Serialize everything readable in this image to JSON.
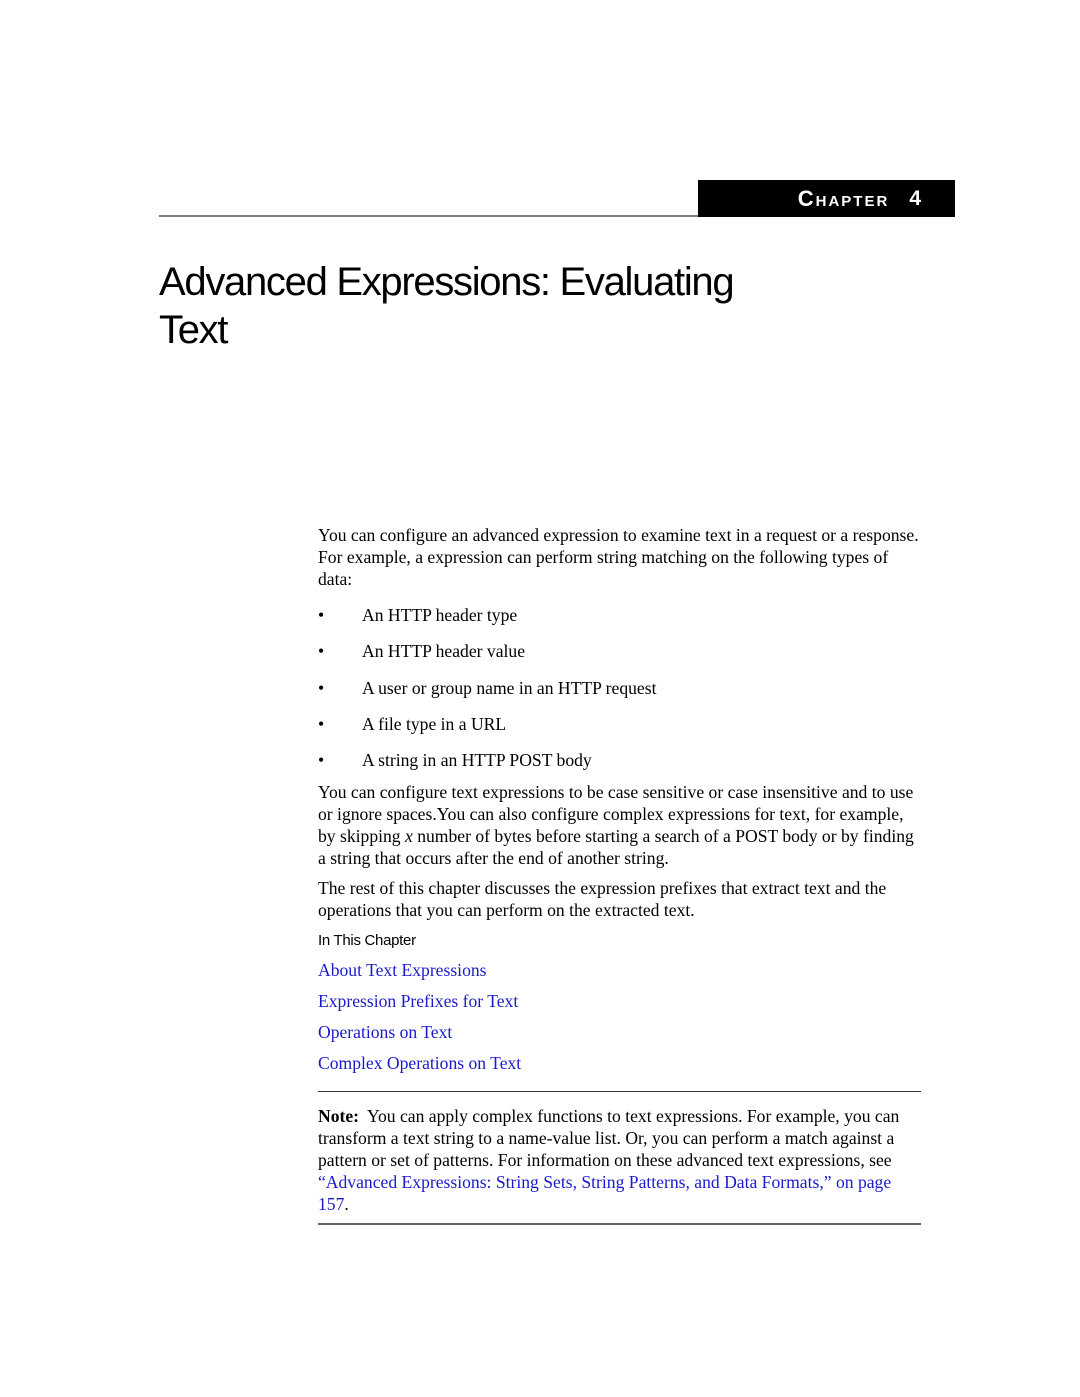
{
  "header": {
    "chapter_label": "Chapter",
    "chapter_number": "4"
  },
  "title": {
    "line1": "Advanced Expressions: Evaluating",
    "line2": "Text"
  },
  "intro": "You can configure an advanced expression to examine text in a request or a response. For example, a expression can perform string matching on the following types of data:",
  "bullets": [
    "An HTTP header type",
    "An HTTP header value",
    "A user or group name in an HTTP request",
    "A file type in a URL",
    "A string in an HTTP POST body"
  ],
  "bullet_glyph": "•",
  "paragraph2": {
    "before_italic": "You can configure text expressions to be case sensitive or case insensitive and to use or ignore spaces.You can also configure complex expressions for text, for example, by skipping ",
    "italic": "x",
    "after_italic": " number of bytes before starting a search of a POST body or by finding a string that occurs after the end of another string."
  },
  "paragraph3": "The rest of this chapter discusses the expression prefixes that extract text and the operations that you can perform on the extracted text.",
  "in_this_chapter": {
    "heading": "In This Chapter",
    "links": [
      "About Text Expressions",
      "Expression Prefixes for Text",
      "Operations on Text",
      "Complex Operations on Text"
    ]
  },
  "note": {
    "label": "Note:",
    "text": "You can apply complex functions to text expressions. For example, you can transform a text string to a name-value list. Or, you can perform a match against a pattern or set of patterns. For information on these advanced text expressions, see ",
    "link": "“Advanced Expressions: String Sets, String Patterns, and Data Formats,” on page 157",
    "end": "."
  },
  "colors": {
    "link": "#1a1acc",
    "chapter_tab_bg": "#000000",
    "chapter_tab_text": "#ffffff"
  }
}
